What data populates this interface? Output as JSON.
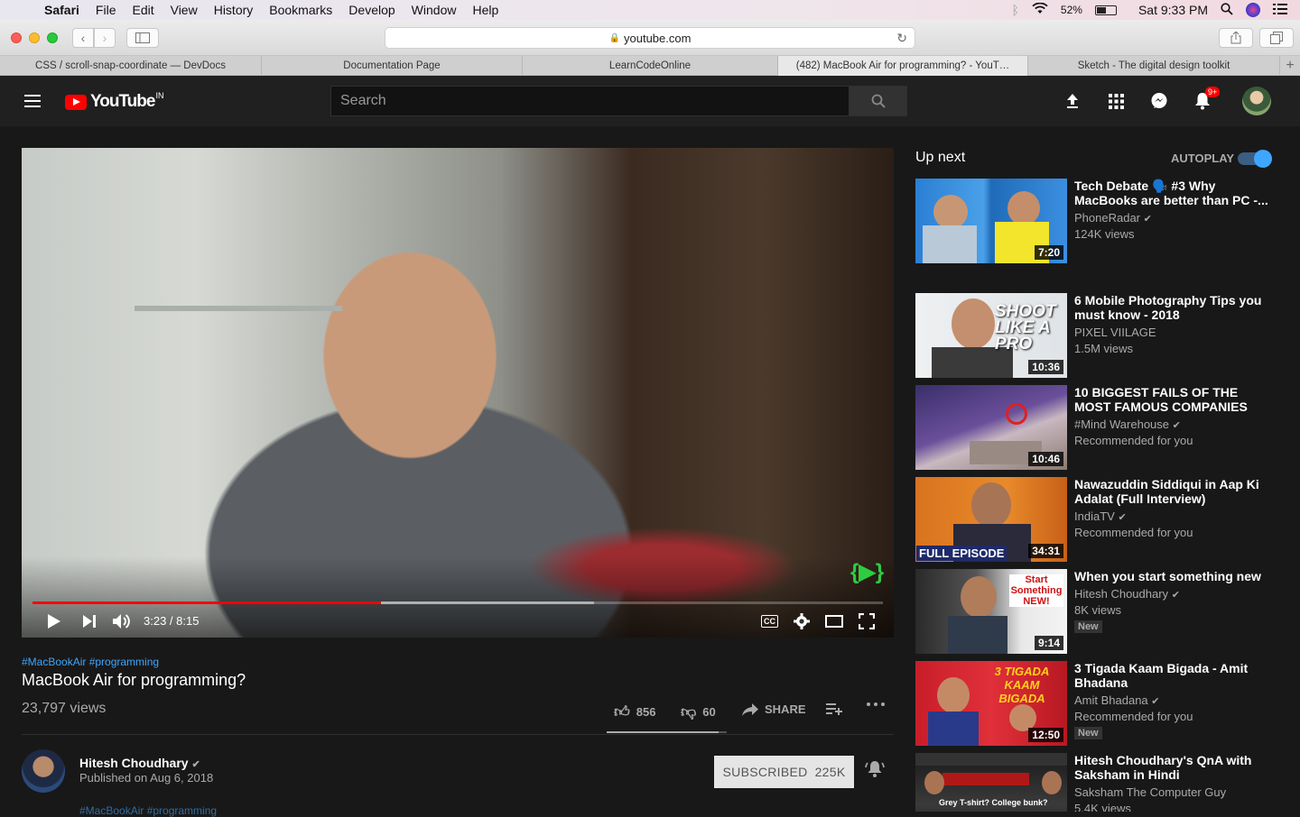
{
  "menubar": {
    "app": "Safari",
    "items": [
      "File",
      "Edit",
      "View",
      "History",
      "Bookmarks",
      "Develop",
      "Window",
      "Help"
    ],
    "battery": "52%",
    "clock": "Sat 9:33 PM",
    "battery_level": 0.52
  },
  "browser": {
    "url": "youtube.com",
    "tabs": [
      "CSS / scroll-snap-coordinate — DevDocs",
      "Documentation Page",
      "LearnCodeOnline",
      "(482) MacBook Air for programming? - YouT…",
      "Sketch - The digital design toolkit"
    ],
    "active_tab": 3
  },
  "header": {
    "logo": "YouTube",
    "country": "IN",
    "search_placeholder": "Search",
    "notifications": "9+"
  },
  "player": {
    "time": "3:23 / 8:15",
    "played_fraction": 0.41,
    "loaded_fraction": 0.66
  },
  "video": {
    "hashtags": "#MacBookAir #programming",
    "title": "MacBook Air for programming?",
    "views": "23,797 views",
    "likes": "856",
    "dislikes": "60",
    "share": "SHARE",
    "like_ratio": 0.93
  },
  "channel": {
    "name": "Hitesh Choudhary",
    "published": "Published on Aug 6, 2018",
    "subscribe_label": "SUBSCRIBED",
    "subscribers": "225K",
    "description_start": "#MacBookAir #programming"
  },
  "upnext": {
    "title": "Up next",
    "autoplay": "AUTOPLAY",
    "autoplay_on": true,
    "items": [
      {
        "title": "Tech Debate 🗣️ #3 Why MacBooks are better than PC -...",
        "channel": "PhoneRadar",
        "meta": "124K views",
        "duration": "7:20",
        "verified": true,
        "new": false
      },
      {
        "title": "6 Mobile Photography Tips you must know - 2018",
        "channel": "PIXEL VIILAGE",
        "meta": "1.5M views",
        "duration": "10:36",
        "verified": false,
        "new": false,
        "overlay": "SHOOT LIKE A PRO"
      },
      {
        "title": "10 BIGGEST FAILS OF THE MOST FAMOUS COMPANIES",
        "channel": "#Mind Warehouse",
        "meta": "Recommended for you",
        "duration": "10:46",
        "verified": true,
        "new": false
      },
      {
        "title": "Nawazuddin Siddiqui in Aap Ki Adalat (Full Interview)",
        "channel": "IndiaTV",
        "meta": "Recommended for you",
        "duration": "34:31",
        "verified": true,
        "new": false,
        "overlay": "FULL EPISODE"
      },
      {
        "title": "When you start something new",
        "channel": "Hitesh Choudhary",
        "meta": "8K views",
        "duration": "9:14",
        "verified": true,
        "new": true,
        "overlay": "Start Something NEW!"
      },
      {
        "title": "3 Tigada Kaam Bigada - Amit Bhadana",
        "channel": "Amit Bhadana",
        "meta": "Recommended for you",
        "duration": "12:50",
        "verified": true,
        "new": true,
        "overlay": "3 TIGADA KAAM BIGADA"
      },
      {
        "title": "Hitesh Choudhary's QnA with Saksham in Hindi",
        "channel": "Saksham The Computer Guy",
        "meta": "5.4K views",
        "duration": "",
        "verified": false,
        "new": false,
        "overlay": "Grey T-shirt? College bunk?"
      }
    ],
    "new_label": "New"
  }
}
